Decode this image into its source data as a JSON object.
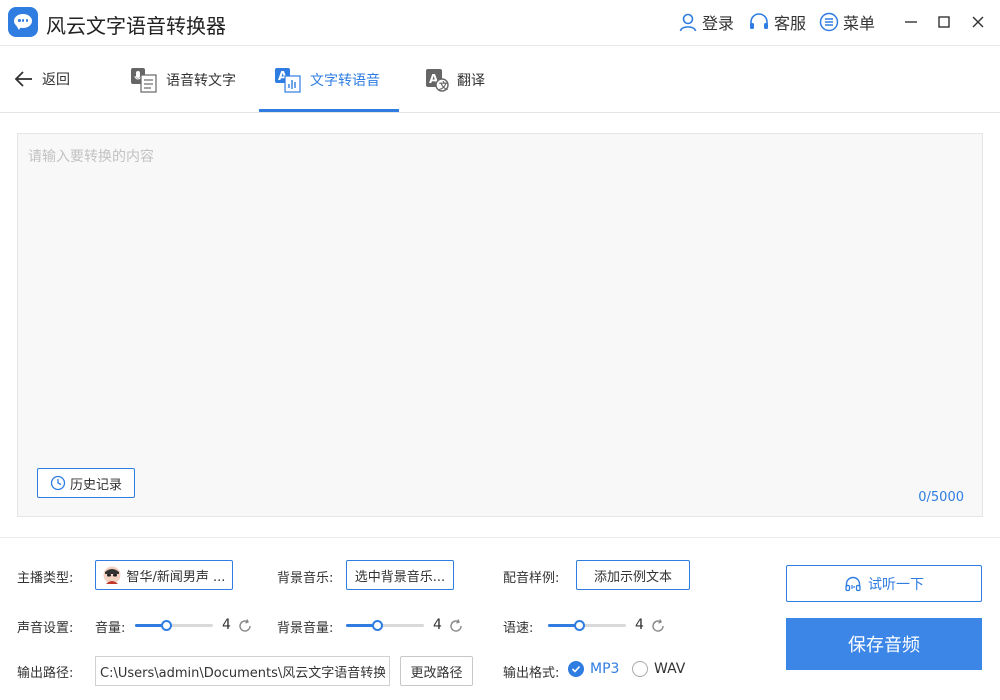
{
  "app": {
    "title": "风云文字语音转换器"
  },
  "header": {
    "login": "登录",
    "service": "客服",
    "menu": "菜单"
  },
  "nav": {
    "back": "返回",
    "tabs": [
      {
        "label": "语音转文字"
      },
      {
        "label": "文字转语音",
        "active": true
      },
      {
        "label": "翻译"
      }
    ]
  },
  "editor": {
    "placeholder": "请输入要转换的内容",
    "history_label": "历史记录",
    "counter": "0/5000"
  },
  "settings": {
    "anchor_type_label": "主播类型:",
    "anchor_value": "智华/新闻男声 ...",
    "bg_music_label": "背景音乐:",
    "bg_music_button": "选中背景音乐...",
    "sample_label": "配音样例:",
    "sample_button": "添加示例文本",
    "sound_label": "声音设置:",
    "volume_label": "音量:",
    "volume_value": "4",
    "bg_volume_label": "背景音量:",
    "bg_volume_value": "4",
    "speed_label": "语速:",
    "speed_value": "4",
    "slider_fraction": 0.4,
    "output_path_label": "输出路径:",
    "output_path_value": "C:\\Users\\admin\\Documents\\风云文字语音转换器",
    "change_path_button": "更改路径",
    "format_label": "输出格式:",
    "formats": [
      {
        "label": "MP3",
        "checked": true
      },
      {
        "label": "WAV",
        "checked": false
      }
    ]
  },
  "actions": {
    "preview": "试听一下",
    "save": "保存音频"
  },
  "colors": {
    "accent": "#2f7de1",
    "save_bg": "#3b86e6",
    "placeholder": "#c2c2c2"
  }
}
